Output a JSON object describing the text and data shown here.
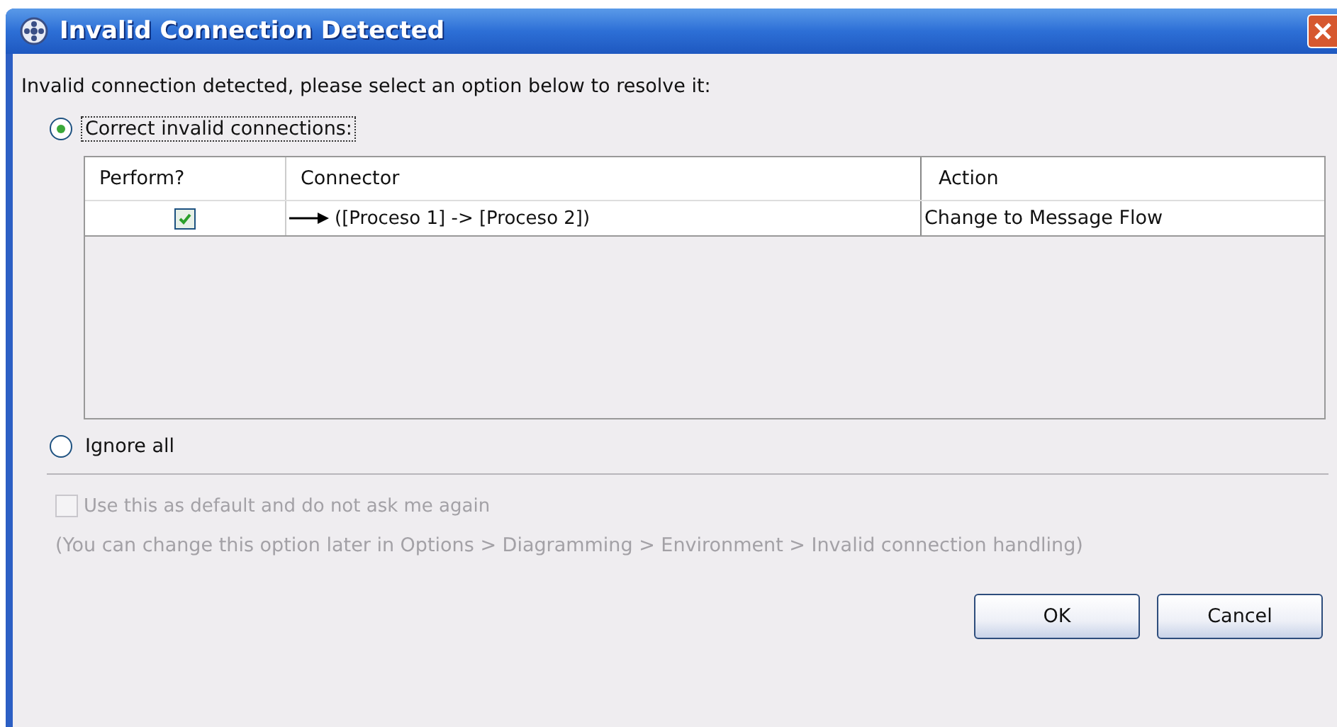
{
  "window": {
    "title": "Invalid Connection Detected"
  },
  "message": "Invalid connection detected, please select an option below to resolve it:",
  "options": [
    {
      "label": "Correct invalid connections:",
      "selected": true,
      "focused": true
    },
    {
      "label": "Ignore all",
      "selected": false,
      "focused": false
    }
  ],
  "table": {
    "columns": [
      "Perform?",
      "Connector",
      "Action"
    ],
    "rows": [
      {
        "perform": true,
        "connector": "([Proceso 1] -> [Proceso 2])",
        "action": "Change to Message Flow"
      }
    ]
  },
  "default_option": {
    "label": "Use this as default and do not ask me again",
    "checked": false,
    "disabled": true
  },
  "note": "(You can change this option later in Options > Diagramming > Environment > Invalid connection handling)",
  "buttons": [
    "OK",
    "Cancel"
  ]
}
